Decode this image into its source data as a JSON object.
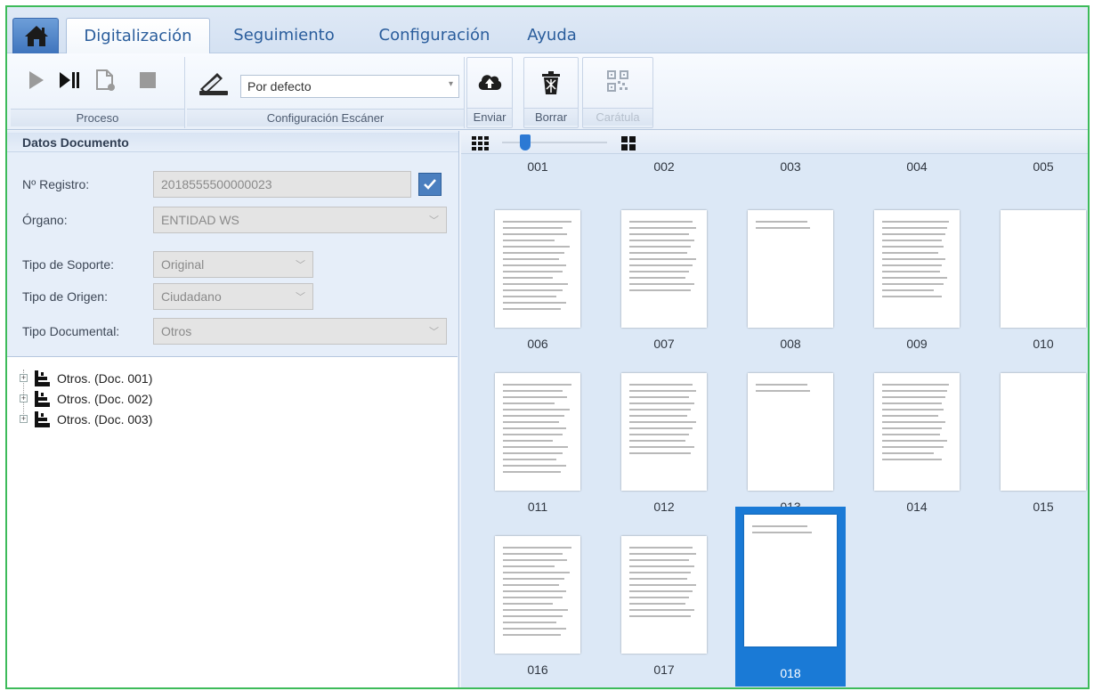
{
  "tabs": [
    {
      "label": "Digitalización",
      "active": true
    },
    {
      "label": "Seguimiento",
      "active": false
    },
    {
      "label": "Configuración",
      "active": false
    },
    {
      "label": "Ayuda",
      "active": false
    }
  ],
  "ribbon": {
    "proceso": {
      "label": "Proceso",
      "buttons": [
        "play-icon",
        "play-pause-icon",
        "new-document-icon",
        "stop-icon"
      ]
    },
    "scanner": {
      "label": "Configuración Escáner",
      "profile": "Por defecto",
      "icon": "scanner-icon"
    },
    "enviar": {
      "label": "Enviar",
      "icon": "cloud-upload-icon"
    },
    "borrar": {
      "label": "Borrar",
      "icon": "trash-icon"
    },
    "caratula": {
      "label": "Carátula",
      "icon": "qr-code-icon",
      "disabled": true
    }
  },
  "datos_documento": {
    "title": "Datos Documento",
    "registro": {
      "label": "Nº Registro:",
      "value": "2018555500000023",
      "checked": true
    },
    "organo": {
      "label": "Órgano:",
      "value": "ENTIDAD WS"
    },
    "tipo_soporte": {
      "label": "Tipo de Soporte:",
      "value": "Original"
    },
    "tipo_origen": {
      "label": "Tipo de Origen:",
      "value": "Ciudadano"
    },
    "tipo_documental": {
      "label": "Tipo Documental:",
      "value": "Otros"
    }
  },
  "tree": [
    {
      "label": "Otros. (Doc. 001)"
    },
    {
      "label": "Otros. (Doc. 002)"
    },
    {
      "label": "Otros. (Doc. 003)"
    }
  ],
  "thumbnails": {
    "row_numbers": [
      "001",
      "002",
      "003",
      "004",
      "005"
    ],
    "pages": [
      {
        "label": "006"
      },
      {
        "label": "007"
      },
      {
        "label": "008"
      },
      {
        "label": "009"
      },
      {
        "label": "010"
      },
      {
        "label": "011"
      },
      {
        "label": "012"
      },
      {
        "label": "013"
      },
      {
        "label": "014"
      },
      {
        "label": "015"
      },
      {
        "label": "016"
      },
      {
        "label": "017"
      },
      {
        "label": "018",
        "selected": true
      }
    ]
  },
  "colors": {
    "accent": "#1a7ad6",
    "tab_text": "#2a5d9c",
    "frame_border": "#3dbb5a"
  }
}
